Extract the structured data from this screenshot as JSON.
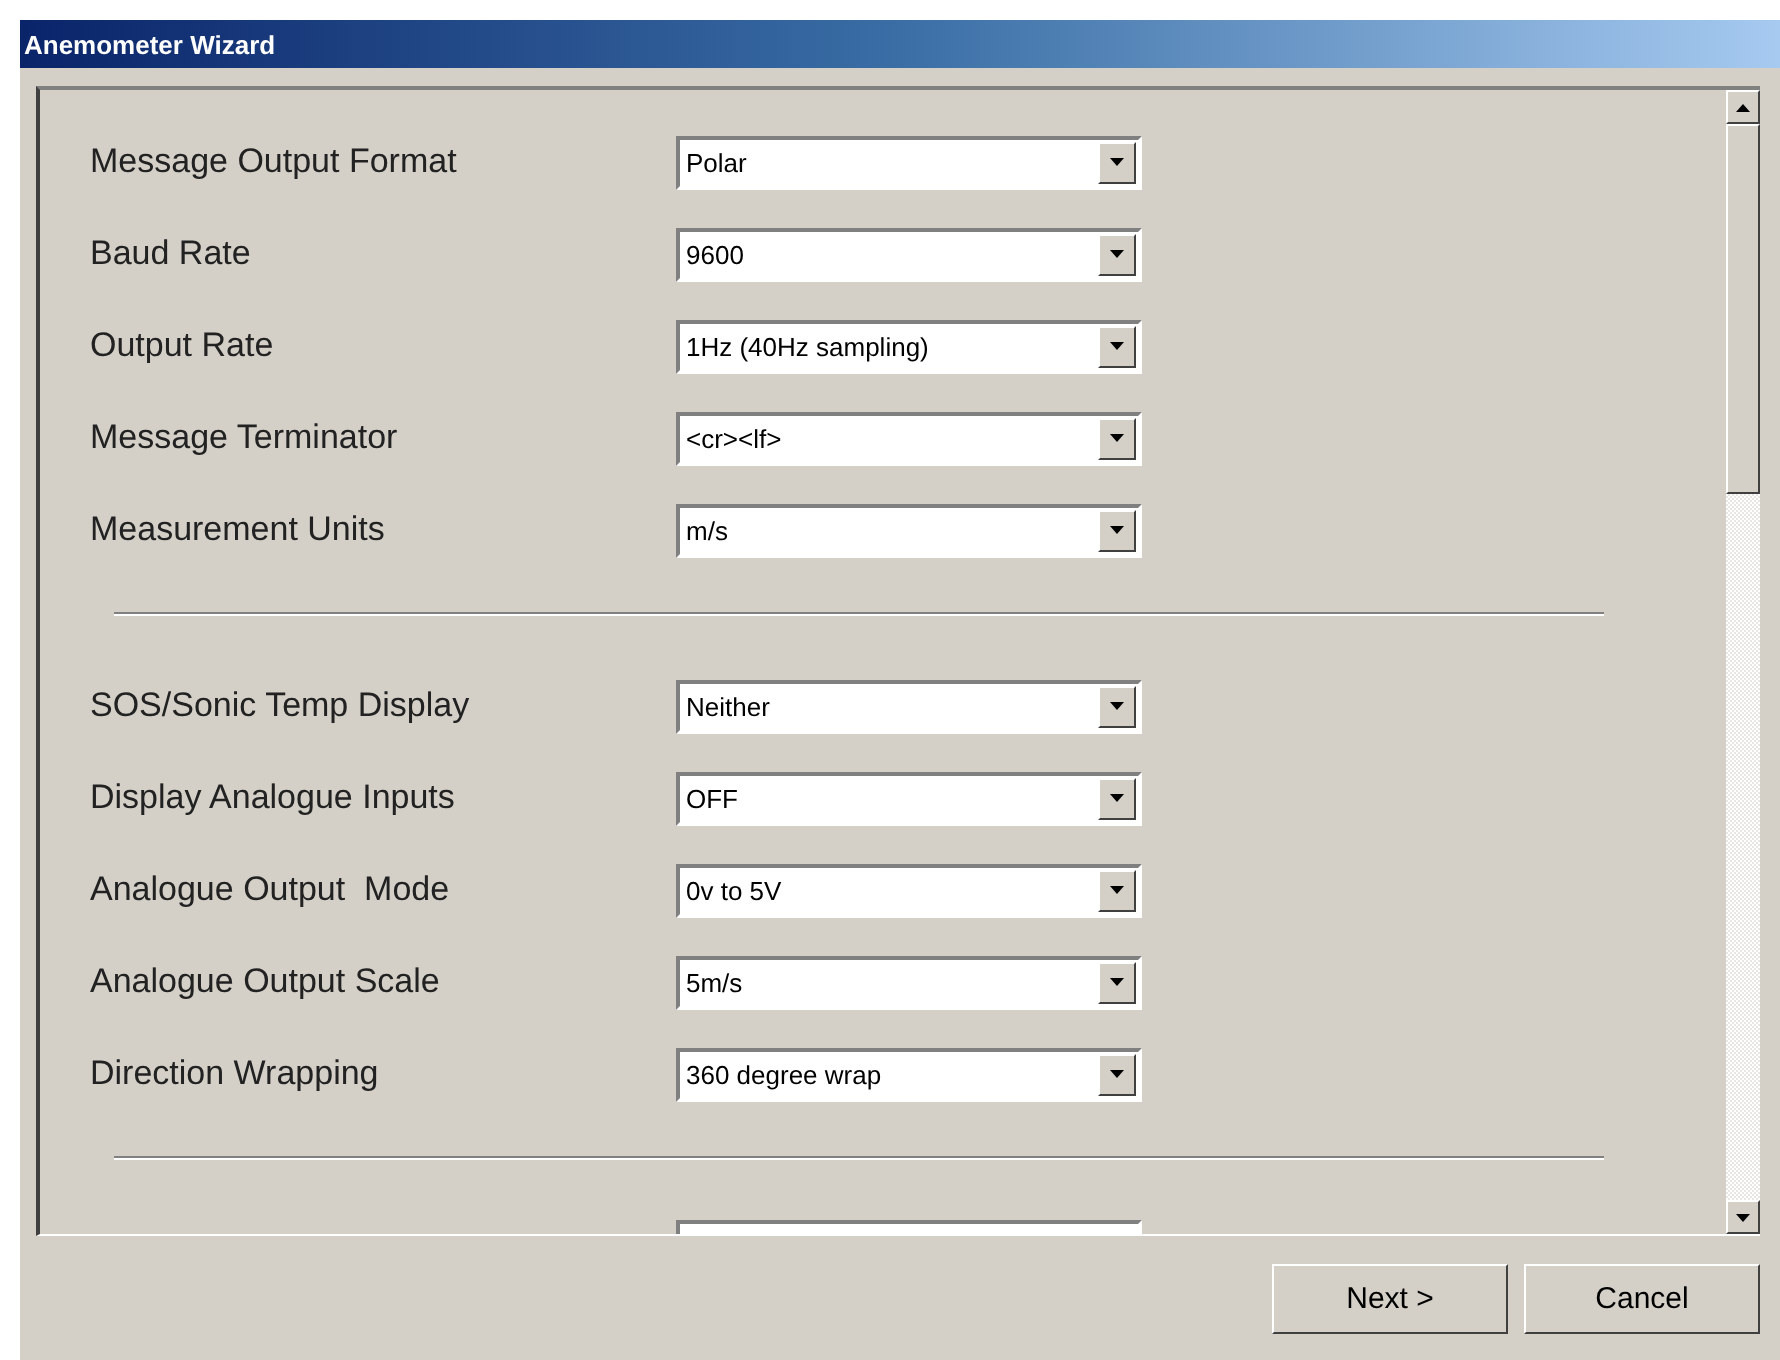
{
  "window": {
    "title": "Anemometer Wizard"
  },
  "sections": [
    {
      "rows": [
        {
          "label": "Message Output Format",
          "value": "Polar"
        },
        {
          "label": "Baud Rate",
          "value": "9600"
        },
        {
          "label": "Output Rate",
          "value": "1Hz (40Hz sampling)"
        },
        {
          "label": "Message Terminator",
          "value": "<cr><lf>"
        },
        {
          "label": "Measurement Units",
          "value": "m/s"
        }
      ]
    },
    {
      "rows": [
        {
          "label": "SOS/Sonic Temp Display",
          "value": "Neither"
        },
        {
          "label": "Display Analogue Inputs",
          "value": "OFF"
        },
        {
          "label": "Analogue Output  Mode",
          "value": "0v to 5V"
        },
        {
          "label": "Analogue Output Scale",
          "value": "5m/s"
        },
        {
          "label": "Direction Wrapping",
          "value": "360 degree wrap"
        }
      ]
    }
  ],
  "buttons": [
    {
      "label": "Next >"
    },
    {
      "label": "Cancel"
    }
  ]
}
